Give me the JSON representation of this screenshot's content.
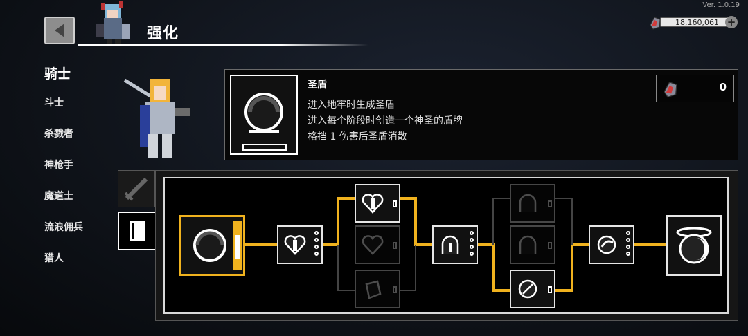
{
  "header": {
    "title": "强化",
    "version": "Ver. 1.0.19",
    "back_label": "back"
  },
  "currency": {
    "amount": "18,160,061",
    "add_label": "+"
  },
  "sidebar": {
    "items": [
      {
        "label": "骑士",
        "active": true
      },
      {
        "label": "斗士"
      },
      {
        "label": "杀戮者"
      },
      {
        "label": "神枪手"
      },
      {
        "label": "魔道士"
      },
      {
        "label": "流浪佣兵"
      },
      {
        "label": "猎人"
      }
    ]
  },
  "detail": {
    "name": "圣盾",
    "lines": [
      "进入地牢时生成圣盾",
      "进入每个阶段时创造一个神圣的盾牌",
      "格挡 1 伤害后圣盾消散"
    ],
    "cost": "0"
  },
  "tabs": [
    {
      "name": "weapon",
      "icon": "sword-icon"
    },
    {
      "name": "book",
      "icon": "book-icon",
      "active": true
    }
  ],
  "colors": {
    "accent": "#f0b21e",
    "panel_border": "#d9d9d9",
    "background": "#10141b"
  }
}
